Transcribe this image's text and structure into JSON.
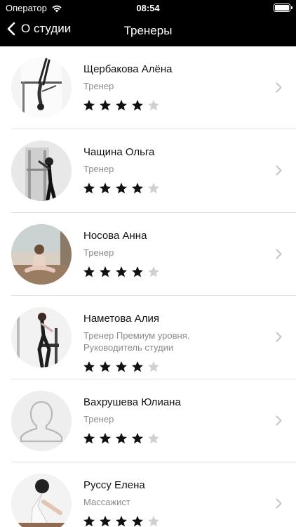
{
  "status_bar": {
    "carrier": "Оператор",
    "time": "08:54",
    "battery_level": 1.0
  },
  "nav": {
    "back_label": "О студии",
    "title": "Тренеры"
  },
  "colors": {
    "bar": "#000000",
    "star_filled": "#111111",
    "star_empty": "#d0d0d0",
    "secondary_text": "#8a8a8a",
    "chevron": "#c4c4c4"
  },
  "trainers": [
    {
      "name": "Щербакова Алёна",
      "role": "Тренер",
      "rating": 4,
      "max_rating": 5
    },
    {
      "name": "Чащина Ольга",
      "role": "Тренер",
      "rating": 4,
      "max_rating": 5
    },
    {
      "name": "Носова Анна",
      "role": "Тренер",
      "rating": 4,
      "max_rating": 5
    },
    {
      "name": "Наметова Алия",
      "role": "Тренер Премиум уровня.\nРуководитель студии",
      "rating": 4,
      "max_rating": 5
    },
    {
      "name": "Вахрушева Юлиана",
      "role": "Тренер",
      "rating": 4,
      "max_rating": 5
    },
    {
      "name": "Руссу Елена",
      "role": "Массажист",
      "rating": 4,
      "max_rating": 5
    }
  ]
}
